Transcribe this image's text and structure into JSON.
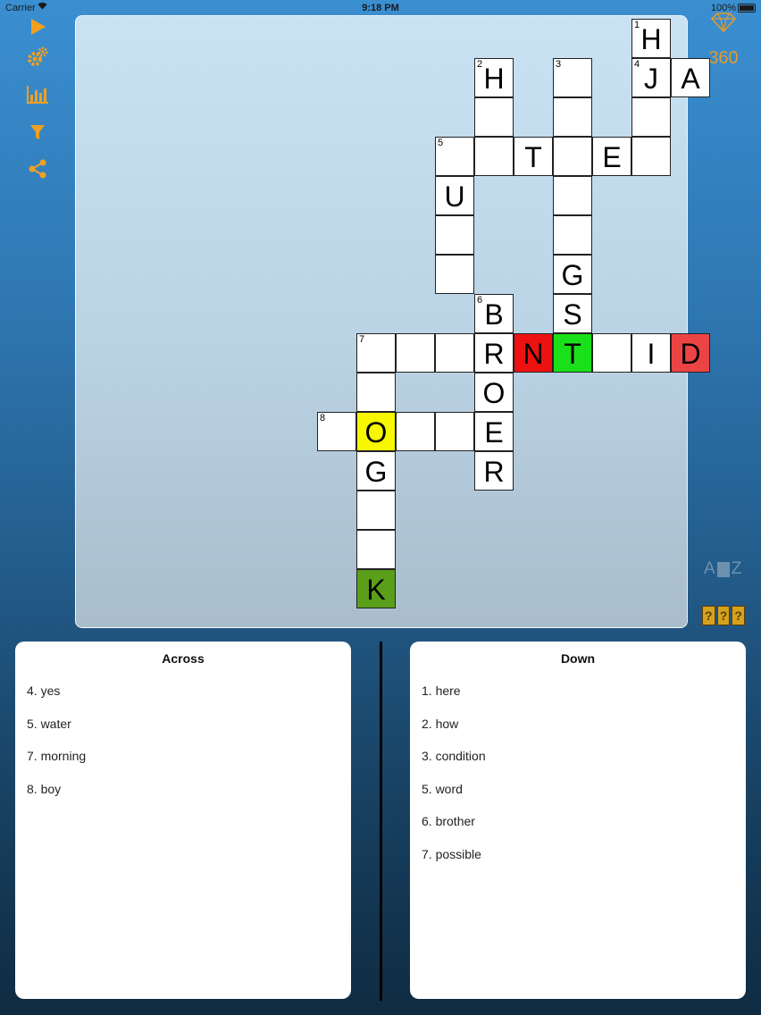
{
  "status_bar": {
    "carrier": "Carrier",
    "time": "9:18 PM",
    "battery": "100%"
  },
  "toolbar": {
    "icons": [
      {
        "name": "play-icon",
        "glyph": "▶"
      },
      {
        "name": "settings-gears-icon",
        "glyph": "⚙"
      },
      {
        "name": "stats-chart-icon",
        "glyph": "chart"
      },
      {
        "name": "filter-icon",
        "glyph": "funnel"
      },
      {
        "name": "share-icon",
        "glyph": "share"
      }
    ]
  },
  "score": {
    "icon": "diamond-icon",
    "gems": "360"
  },
  "colors": {
    "accent": "#f0a020",
    "correct": "#19e019",
    "wrong": "#ee1111",
    "wrong_light": "#ec4444",
    "selected": "#f7f700",
    "revealed": "#5a9f1a"
  },
  "grid": {
    "cells": [
      {
        "row": 0,
        "col": 11,
        "num": "1",
        "letter": "H",
        "state": "normal"
      },
      {
        "row": 1,
        "col": 7,
        "num": "2",
        "letter": "H",
        "state": "normal"
      },
      {
        "row": 1,
        "col": 9,
        "num": "3",
        "letter": "",
        "state": "normal"
      },
      {
        "row": 1,
        "col": 11,
        "num": "4",
        "letter": "J",
        "state": "normal"
      },
      {
        "row": 1,
        "col": 12,
        "num": "",
        "letter": "A",
        "state": "normal"
      },
      {
        "row": 2,
        "col": 7,
        "num": "",
        "letter": "",
        "state": "normal"
      },
      {
        "row": 2,
        "col": 9,
        "num": "",
        "letter": "",
        "state": "normal"
      },
      {
        "row": 2,
        "col": 11,
        "num": "",
        "letter": "",
        "state": "normal"
      },
      {
        "row": 3,
        "col": 6,
        "num": "5",
        "letter": "",
        "state": "normal"
      },
      {
        "row": 3,
        "col": 7,
        "num": "",
        "letter": "",
        "state": "normal"
      },
      {
        "row": 3,
        "col": 8,
        "num": "",
        "letter": "T",
        "state": "normal"
      },
      {
        "row": 3,
        "col": 9,
        "num": "",
        "letter": "",
        "state": "normal"
      },
      {
        "row": 3,
        "col": 10,
        "num": "",
        "letter": "E",
        "state": "normal"
      },
      {
        "row": 3,
        "col": 11,
        "num": "",
        "letter": "",
        "state": "normal"
      },
      {
        "row": 4,
        "col": 6,
        "num": "",
        "letter": "U",
        "state": "normal"
      },
      {
        "row": 4,
        "col": 9,
        "num": "",
        "letter": "",
        "state": "normal"
      },
      {
        "row": 5,
        "col": 6,
        "num": "",
        "letter": "",
        "state": "normal"
      },
      {
        "row": 5,
        "col": 9,
        "num": "",
        "letter": "",
        "state": "normal"
      },
      {
        "row": 6,
        "col": 6,
        "num": "",
        "letter": "",
        "state": "normal"
      },
      {
        "row": 6,
        "col": 9,
        "num": "",
        "letter": "G",
        "state": "normal"
      },
      {
        "row": 7,
        "col": 7,
        "num": "6",
        "letter": "B",
        "state": "normal"
      },
      {
        "row": 7,
        "col": 9,
        "num": "",
        "letter": "S",
        "state": "normal"
      },
      {
        "row": 8,
        "col": 4,
        "num": "7",
        "letter": "",
        "state": "normal"
      },
      {
        "row": 8,
        "col": 5,
        "num": "",
        "letter": "",
        "state": "normal"
      },
      {
        "row": 8,
        "col": 6,
        "num": "",
        "letter": "",
        "state": "normal"
      },
      {
        "row": 8,
        "col": 7,
        "num": "",
        "letter": "R",
        "state": "normal"
      },
      {
        "row": 8,
        "col": 8,
        "num": "",
        "letter": "N",
        "state": "wrong"
      },
      {
        "row": 8,
        "col": 9,
        "num": "",
        "letter": "T",
        "state": "correct"
      },
      {
        "row": 8,
        "col": 10,
        "num": "",
        "letter": "",
        "state": "normal"
      },
      {
        "row": 8,
        "col": 11,
        "num": "",
        "letter": "I",
        "state": "normal"
      },
      {
        "row": 8,
        "col": 12,
        "num": "",
        "letter": "D",
        "state": "wrong_light"
      },
      {
        "row": 9,
        "col": 4,
        "num": "",
        "letter": "",
        "state": "normal"
      },
      {
        "row": 9,
        "col": 7,
        "num": "",
        "letter": "O",
        "state": "normal"
      },
      {
        "row": 10,
        "col": 3,
        "num": "8",
        "letter": "",
        "state": "normal"
      },
      {
        "row": 10,
        "col": 4,
        "num": "",
        "letter": "O",
        "state": "selected"
      },
      {
        "row": 10,
        "col": 5,
        "num": "",
        "letter": "",
        "state": "normal"
      },
      {
        "row": 10,
        "col": 6,
        "num": "",
        "letter": "",
        "state": "normal"
      },
      {
        "row": 10,
        "col": 7,
        "num": "",
        "letter": "E",
        "state": "normal"
      },
      {
        "row": 11,
        "col": 4,
        "num": "",
        "letter": "G",
        "state": "normal"
      },
      {
        "row": 11,
        "col": 7,
        "num": "",
        "letter": "R",
        "state": "normal"
      },
      {
        "row": 12,
        "col": 4,
        "num": "",
        "letter": "",
        "state": "normal"
      },
      {
        "row": 13,
        "col": 4,
        "num": "",
        "letter": "",
        "state": "normal"
      },
      {
        "row": 14,
        "col": 4,
        "num": "",
        "letter": "K",
        "state": "revealed"
      }
    ]
  },
  "side_tools": {
    "az": [
      "A",
      "Z"
    ],
    "hint": [
      "?",
      "?",
      "?"
    ]
  },
  "clues": {
    "across": {
      "title": "Across",
      "items": [
        "4. yes",
        "5. water",
        "7. morning",
        "8. boy"
      ]
    },
    "down": {
      "title": "Down",
      "items": [
        "1. here",
        "2. how",
        "3. condition",
        "5. word",
        "6. brother",
        "7. possible"
      ]
    }
  }
}
